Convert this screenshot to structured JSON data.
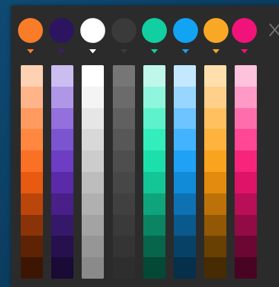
{
  "palette": {
    "columns": [
      {
        "name": "orange",
        "base": "#f97d28",
        "caret": "#f97d28",
        "shades": [
          "#ffd1b3",
          "#ffb48a",
          "#ff9a60",
          "#ff8740",
          "#fa7024",
          "#e85a12",
          "#bb460c",
          "#8a3308",
          "#5e2205",
          "#3d1603"
        ]
      },
      {
        "name": "purple",
        "base": "#2d1460",
        "caret": "#3a1d78",
        "shades": [
          "#ccbdf0",
          "#b096e6",
          "#9370db",
          "#7b54cf",
          "#6d3dc4",
          "#5a2aa8",
          "#482088",
          "#36186a",
          "#26104e",
          "#1a0a36"
        ]
      },
      {
        "name": "white",
        "base": "#ffffff",
        "caret": "#ffffff",
        "shades": [
          "#ffffff",
          "#f4f4f4",
          "#e6e6e6",
          "#d8d8d8",
          "#cccccc",
          "#bdbdbd",
          "#b0b0b0",
          "#a3a3a3",
          "#969696",
          "#8a8a8a"
        ]
      },
      {
        "name": "dark-gray",
        "base": "#3a3a3a",
        "caret": "#3a3a3a",
        "shades": [
          "#767676",
          "#6b6b6b",
          "#606060",
          "#575757",
          "#4e4e4e",
          "#474747",
          "#404040",
          "#3a3a3a",
          "#343434",
          "#2e2e2e"
        ]
      },
      {
        "name": "teal",
        "base": "#12cfa2",
        "caret": "#12cfa2",
        "shades": [
          "#bff8ea",
          "#8ff5dc",
          "#5ef2cc",
          "#33edbc",
          "#1ddfac",
          "#14c596",
          "#0fa47c",
          "#0a8463",
          "#07654b",
          "#044836"
        ]
      },
      {
        "name": "sky-blue",
        "base": "#12a3f2",
        "caret": "#12a3f2",
        "shades": [
          "#c4e8ff",
          "#99d6ff",
          "#6dc4ff",
          "#44b3ff",
          "#1fa2f5",
          "#118ad8",
          "#0d71b2",
          "#0a598c",
          "#074266",
          "#052f4a"
        ]
      },
      {
        "name": "amber",
        "base": "#f9a826",
        "caret": "#f9a826",
        "shades": [
          "#ffe0ad",
          "#ffd08a",
          "#ffc060",
          "#ffb33f",
          "#f9a31f",
          "#e38b0e",
          "#bc7208",
          "#925805",
          "#694003",
          "#472b02"
        ]
      },
      {
        "name": "pink",
        "base": "#f1137a",
        "caret": "#f1137a",
        "shades": [
          "#ffc2dc",
          "#ff99c5",
          "#ff6eac",
          "#ff4794",
          "#f7247c",
          "#de1469",
          "#b90f57",
          "#920b45",
          "#6b0733",
          "#4a0423"
        ]
      }
    ]
  },
  "icons": {
    "close": "close-icon"
  }
}
